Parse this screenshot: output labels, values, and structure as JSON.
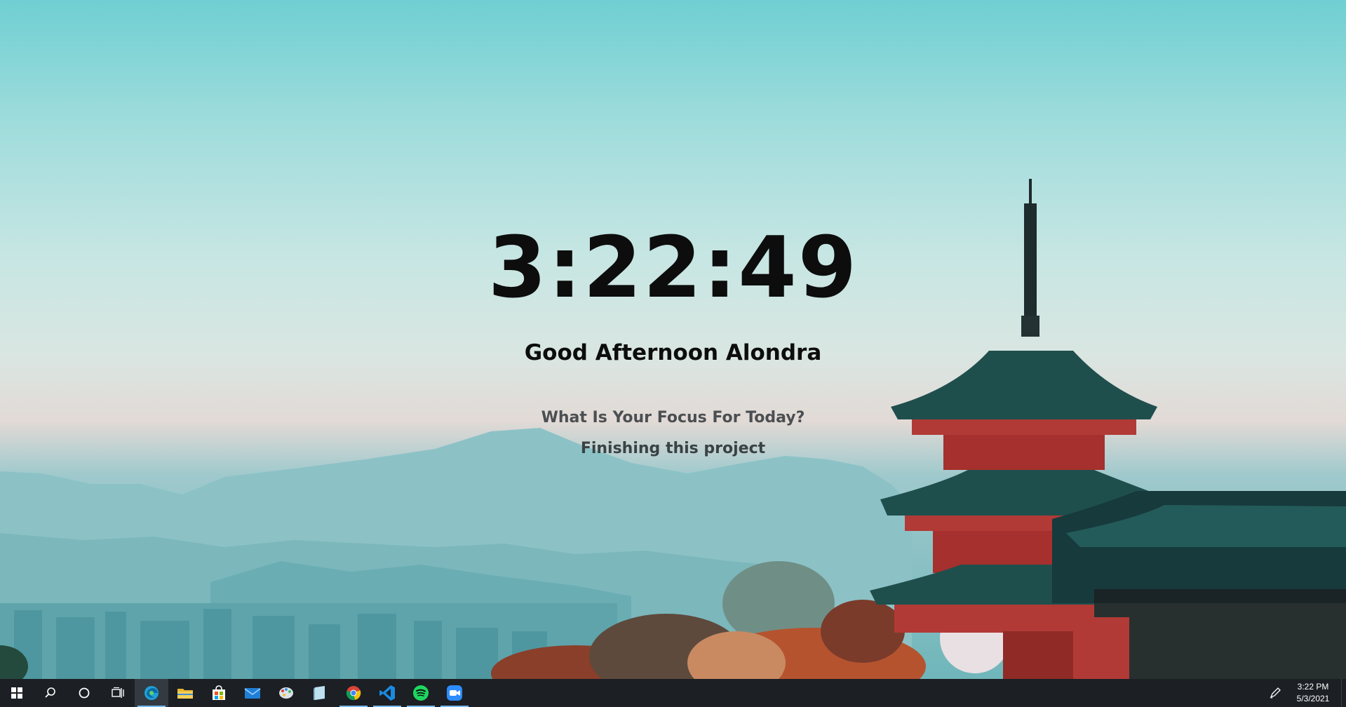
{
  "clock": {
    "time": "3:22:49"
  },
  "greeting": {
    "text": "Good Afternoon Alondra"
  },
  "focus": {
    "question": "What Is Your Focus For Today?",
    "answer": "Finishing this project"
  },
  "taskbar": {
    "items": [
      {
        "name": "start",
        "icon": "windows-logo-icon"
      },
      {
        "name": "search",
        "icon": "search-icon"
      },
      {
        "name": "cortana",
        "icon": "cortana-circle-icon"
      },
      {
        "name": "task-view",
        "icon": "task-view-icon"
      },
      {
        "name": "edge",
        "icon": "edge-icon",
        "active": true
      },
      {
        "name": "file-explorer",
        "icon": "folder-icon"
      },
      {
        "name": "store",
        "icon": "store-icon"
      },
      {
        "name": "mail",
        "icon": "mail-icon"
      },
      {
        "name": "paint",
        "icon": "paint-icon"
      },
      {
        "name": "notes",
        "icon": "notes-icon"
      },
      {
        "name": "chrome",
        "icon": "chrome-icon",
        "running": true
      },
      {
        "name": "vscode",
        "icon": "vscode-icon",
        "running": true
      },
      {
        "name": "spotify",
        "icon": "spotify-icon",
        "running": true
      },
      {
        "name": "zoom",
        "icon": "zoom-icon",
        "running": true
      }
    ],
    "tray": {
      "pen_icon": "pen-workspace-icon",
      "time": "3:22 PM",
      "date": "5/3/2021"
    }
  },
  "colors": {
    "taskbar_bg": "#1c1f24",
    "running_indicator": "#76b9ed",
    "clock_text": "#0d0d0d",
    "focus_text": "#4b4f52"
  }
}
